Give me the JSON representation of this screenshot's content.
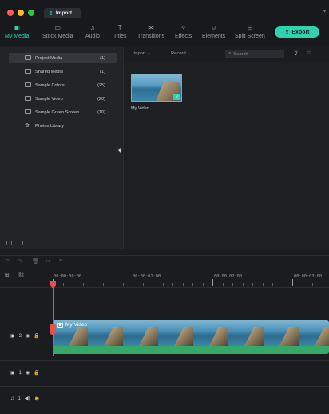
{
  "titlebar": {
    "import_label": "Import"
  },
  "tabs": [
    {
      "label": "My Media",
      "icon": "media-icon",
      "glyph": "▣"
    },
    {
      "label": "Stock Media",
      "icon": "stock-media-icon",
      "glyph": "▭"
    },
    {
      "label": "Audio",
      "icon": "audio-icon",
      "glyph": "♫"
    },
    {
      "label": "Titles",
      "icon": "titles-icon",
      "glyph": "T"
    },
    {
      "label": "Transitions",
      "icon": "transitions-icon",
      "glyph": "⋈"
    },
    {
      "label": "Effects",
      "icon": "effects-icon",
      "glyph": "✧"
    },
    {
      "label": "Elements",
      "icon": "elements-icon",
      "glyph": "☺"
    },
    {
      "label": "Split Screen",
      "icon": "split-screen-icon",
      "glyph": "⊟"
    }
  ],
  "export_label": "Export",
  "sidebar": {
    "items": [
      {
        "label": "Project Media",
        "count": "(1)"
      },
      {
        "label": "Shared Media",
        "count": "(1)"
      },
      {
        "label": "Sample Colors",
        "count": "(25)"
      },
      {
        "label": "Sample Video",
        "count": "(20)"
      },
      {
        "label": "Sample Green Screen",
        "count": "(10)"
      },
      {
        "label": "Photos Library",
        "count": ""
      }
    ]
  },
  "media_toolbar": {
    "import_dropdown": "Import ⌄",
    "record_dropdown": "Record ⌄",
    "search_placeholder": "Search"
  },
  "media_items": [
    {
      "label": "My Video"
    }
  ],
  "timeline": {
    "timecodes": [
      "00:00:00:00",
      "00:00:01:00",
      "00:00:02:00",
      "00:00:03:00"
    ],
    "tracks": [
      {
        "label": "2",
        "type": "video",
        "clip_title": "My Video"
      },
      {
        "label": "1",
        "type": "video"
      },
      {
        "label": "1",
        "type": "audio"
      }
    ]
  },
  "colors": {
    "accent": "#2ed3ad",
    "playhead": "#e84f4f",
    "audio_wave": "#36a868"
  }
}
